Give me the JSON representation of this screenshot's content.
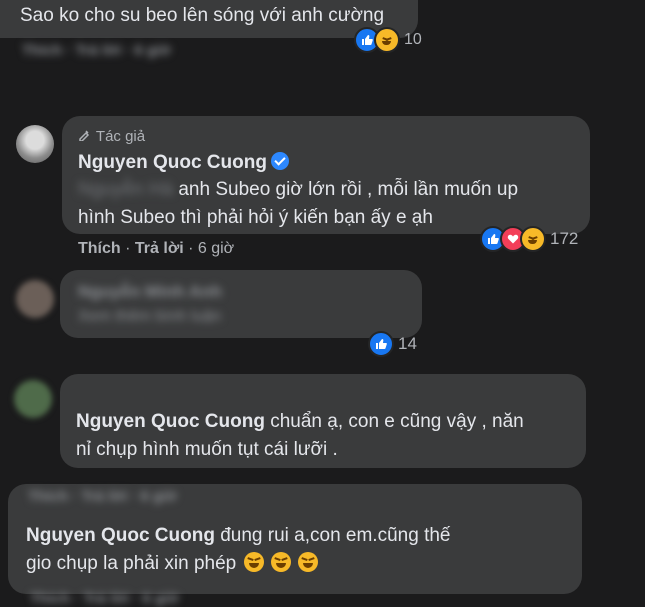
{
  "comments": [
    {
      "text": "Sao ko cho su beo lên sóng với anh cường",
      "reaction_count": "10",
      "actions_blurred": "Thích · Trả lời · 6 giờ"
    },
    {
      "badge": "Tác giả",
      "author": "Nguyen Quoc Cuong",
      "blurred_prefix": "Nguyễn Hà",
      "text_line1": "anh Subeo giờ lớn rồi , mỗi lần muốn up",
      "text_line2": "hình Subeo thì phải hỏi ý kiến bạn ấy e ạh",
      "reaction_count": "172",
      "like_label": "Thích",
      "reply_label": "Trả lời",
      "time": "6 giờ"
    },
    {
      "blurred_name": "Nguyễn Minh Anh",
      "blurred_text": "Xem thêm bình luận",
      "reaction_count": "14"
    },
    {
      "author": "Nguyen Quoc Cuong",
      "text_line1": "chuẩn ạ, con e cũng vậy , năn",
      "text_line2": "nỉ chụp hình muốn tụt cái lưỡi ."
    },
    {
      "blurred_top": "Thích · Trả lời · 6 giờ",
      "author": "Nguyen Quoc Cuong",
      "text_line1": "đung rui a,con em.cũng thế",
      "text_line2": "gio chụp la phải xin phép",
      "actions_blurred": "Thích · Trả lời · 6 giờ"
    }
  ],
  "icons": {
    "like": "like-icon",
    "haha": "haha-icon",
    "love": "love-icon",
    "verified": "verified-badge-icon",
    "author": "author-badge-icon"
  },
  "colors": {
    "background": "#1b1b1c",
    "bubble": "#3a3b3c",
    "like": "#1877f2",
    "haha": "#f7b928",
    "love": "#f33e58",
    "verified": "#2d88ff"
  }
}
